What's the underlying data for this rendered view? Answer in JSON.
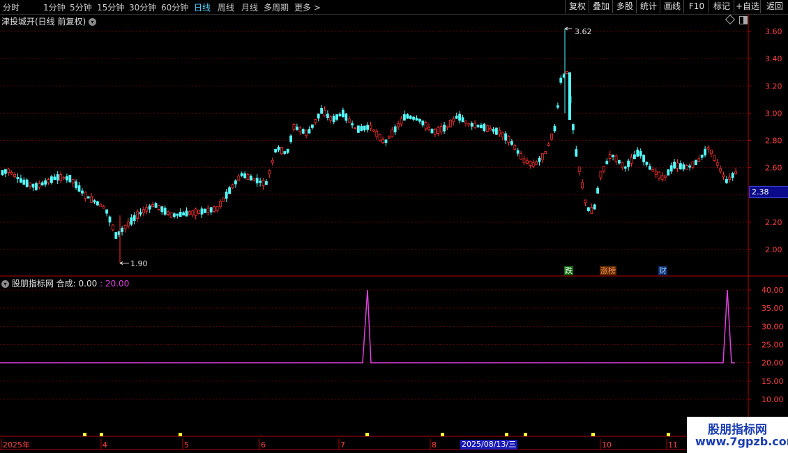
{
  "toolbar": {
    "periods": [
      "分时",
      "1分钟",
      "5分钟",
      "15分钟",
      "30分钟",
      "60分钟",
      "日线",
      "周线",
      "月线",
      "多周期",
      "更多 >"
    ],
    "active_period": "日线",
    "buttons": [
      "复权",
      "叠加",
      "多股",
      "统计",
      "画线",
      "F10",
      "标记",
      "+自选",
      "返回"
    ]
  },
  "chart": {
    "title": "津投城开(日线 前复权)",
    "y_axis_labels": [
      "3.60",
      "3.40",
      "3.20",
      "3.00",
      "2.80",
      "2.60",
      "2.40",
      "2.20",
      "2.00"
    ],
    "max_label": "3.62",
    "min_label": "1.90",
    "current_price": "2.38",
    "tags": [
      "跌",
      "涨榜",
      "财"
    ],
    "up_color": "#ff3030",
    "down_color": "#54ffff"
  },
  "indicator": {
    "name": "股朋指标网",
    "label": "合成:",
    "value1": "0.00",
    "value2": "20.00",
    "y_axis_labels": [
      "40.00",
      "35.00",
      "30.00",
      "25.00",
      "20.00",
      "15.00",
      "10.00"
    ],
    "line_color": "#e040e0"
  },
  "x_axis": {
    "labels": [
      "2025年",
      "4",
      "5",
      "6",
      "7",
      "8",
      "10",
      "11"
    ],
    "cursor_date": "2025/08/13/三"
  },
  "watermark": {
    "title": "股朋指标网",
    "url": "www.7gpzb.com"
  }
}
